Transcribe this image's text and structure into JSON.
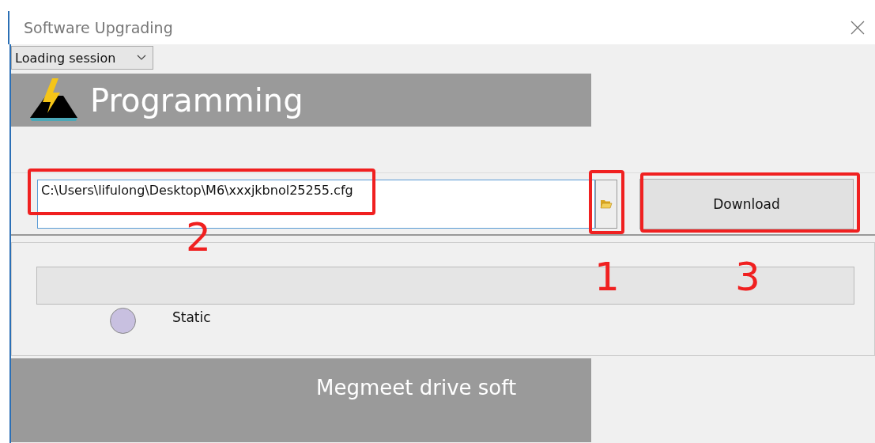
{
  "window": {
    "title": "Software Upgrading"
  },
  "session_dropdown": {
    "value": "Loading session"
  },
  "banner": {
    "title": "Programming"
  },
  "file_path": {
    "value": "C:\\Users\\lifulong\\Desktop\\M6\\xxxjkbnol25255.cfg"
  },
  "download_button": {
    "label": "Download"
  },
  "progress": {
    "level": 0
  },
  "status": {
    "label": "Static",
    "color": "#c8c0e0"
  },
  "footer": {
    "text": "Megmeet drive soft"
  },
  "annotations": [
    {
      "label": "1"
    },
    {
      "label": "2"
    },
    {
      "label": "3"
    }
  ]
}
